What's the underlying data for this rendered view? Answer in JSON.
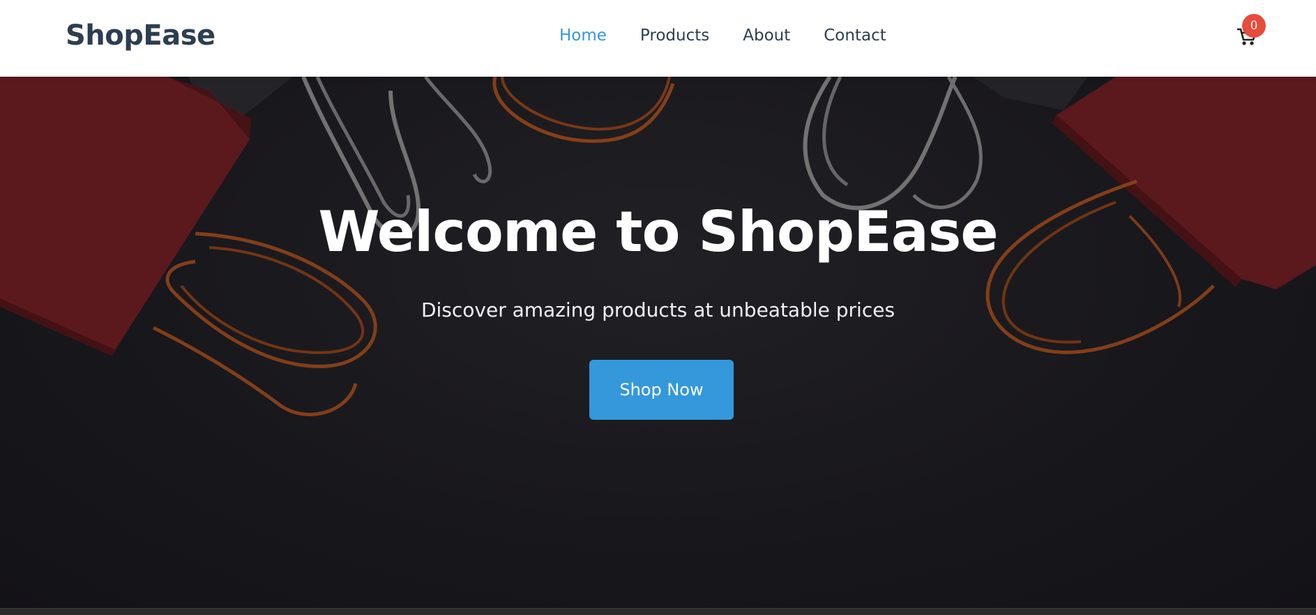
{
  "brand": {
    "name": "ShopEase",
    "color": "#2c3e50"
  },
  "nav": {
    "links": [
      {
        "label": "Home",
        "active": true
      },
      {
        "label": "Products",
        "active": false
      },
      {
        "label": "About",
        "active": false
      },
      {
        "label": "Contact",
        "active": false
      }
    ],
    "active_color": "#3498db"
  },
  "cart": {
    "icon": "cart-icon",
    "count": "0",
    "badge_color": "#e74c3c"
  },
  "hero": {
    "title": "Welcome to ShopEase",
    "subtitle": "Discover amazing products at unbeatable prices",
    "cta_label": "Shop Now",
    "cta_color": "#3498db"
  }
}
